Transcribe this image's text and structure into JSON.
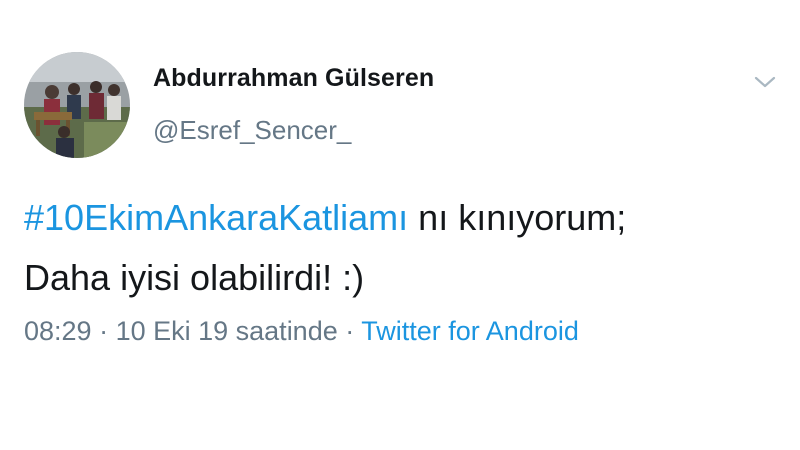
{
  "user": {
    "display_name": "Abdurrahman Gülseren",
    "handle": "@Esref_Sencer_"
  },
  "tweet": {
    "hashtag": "#10EkimAnkaraKatliamı",
    "text_after_hashtag": " nı kınıyorum;",
    "second_line": "Daha iyisi olabilirdi! :)"
  },
  "meta": {
    "time": "08:29",
    "separator": " · ",
    "date": "10 Eki 19 saatinde",
    "separator2": " · ",
    "source": "Twitter for Android"
  },
  "icons": {
    "menu": "chevron-down-icon",
    "avatar": "profile-photo"
  },
  "colors": {
    "link": "#1b95e0",
    "secondary_text": "#657786",
    "primary_text": "#14171a"
  }
}
